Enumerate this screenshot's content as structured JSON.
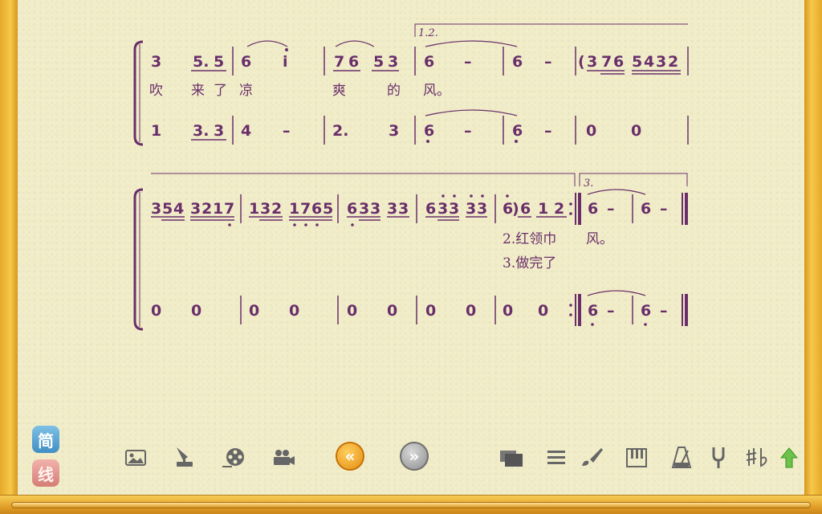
{
  "system1": {
    "volta": "1.2.",
    "melody": [
      "3",
      "5.",
      "5",
      "6",
      "i",
      "7",
      "6",
      "5",
      "3",
      "6",
      "–",
      "6",
      "–",
      "(",
      "3",
      "7",
      "6",
      "5",
      "4",
      "3",
      "2"
    ],
    "lyrics": [
      "吹",
      "来",
      "了",
      "凉",
      "爽",
      "的",
      "风。"
    ],
    "bass": [
      "1",
      "3.",
      "3",
      "4",
      "–",
      "2.",
      "3",
      "6",
      "–",
      "6",
      "–",
      "0",
      "0"
    ]
  },
  "system2": {
    "volta": "3.",
    "melody": [
      "3",
      "5",
      "4",
      "3",
      "2",
      "1",
      "7",
      "1",
      "3",
      "2",
      "1",
      "7",
      "6",
      "5",
      "6",
      "3",
      "3",
      "3",
      "3",
      "6",
      "3",
      "3",
      "3",
      "3",
      "6",
      ")",
      "6",
      "1",
      "2",
      "6",
      "–",
      "6",
      "–"
    ],
    "lyrics2": [
      "2.红领巾",
      "风。"
    ],
    "lyrics3": [
      "3.做完了"
    ],
    "bass": [
      "0",
      "0",
      "0",
      "0",
      "0",
      "0",
      "0",
      "0",
      "0",
      "0",
      "6",
      "–",
      "6",
      "–"
    ]
  },
  "side": {
    "jianpu_label": "简",
    "staff_label": "线"
  },
  "toolbar": {
    "icons": [
      "image-icon",
      "gramophone-icon",
      "film-reel-icon",
      "camera-icon",
      "windows-icon",
      "list-icon",
      "brush-icon",
      "piano-icon",
      "metronome-icon",
      "tuning-fork-icon",
      "sharp-flat-icon",
      "up-arrow-icon"
    ],
    "prev_label": "«",
    "next_label": "»"
  },
  "colors": {
    "ink": "#6a2f6a",
    "frame": "#e6a92a",
    "paper": "#f1edc9"
  }
}
